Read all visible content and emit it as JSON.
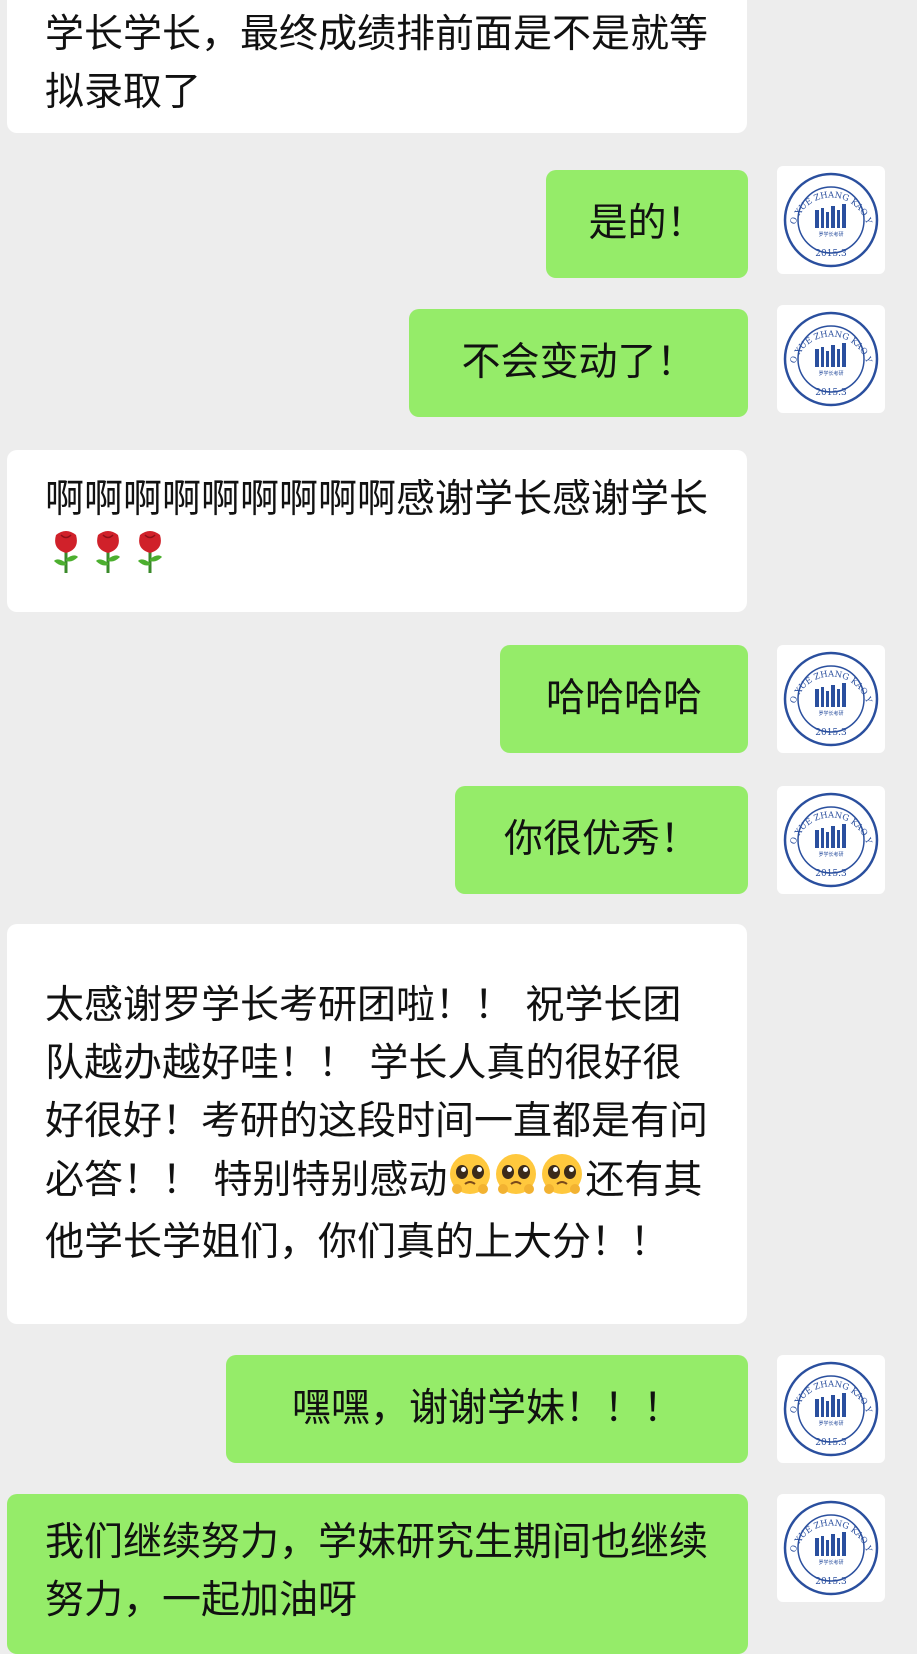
{
  "messages": [
    {
      "side": "left",
      "text": "学长学长，最终成绩排前面是不是就等拟录取了"
    },
    {
      "side": "right",
      "text": "是的！"
    },
    {
      "side": "right",
      "text": "不会变动了！"
    },
    {
      "side": "left",
      "text": "啊啊啊啊啊啊啊啊啊感谢学长感谢学长",
      "emoji": [
        "rose-icon",
        "rose-icon",
        "rose-icon"
      ]
    },
    {
      "side": "right",
      "text": "哈哈哈哈"
    },
    {
      "side": "right",
      "text": "你很优秀！"
    },
    {
      "side": "left",
      "text_a": "太感谢罗学长考研团啦！！ 祝学长团队越办越好哇！！ 学长人真的很好很好很好！考研的这段时间一直都是有问必答！！ 特别特别感动",
      "emoji": [
        "pleading-face-icon",
        "pleading-face-icon",
        "pleading-face-icon"
      ],
      "text_b": "还有其他学长学姐们，你们真的上大分！！"
    },
    {
      "side": "right",
      "text": "嘿嘿，谢谢学妹！！！"
    },
    {
      "side": "right",
      "text": "我们继续努力，学妹研究生期间也继续努力，一起加油呀"
    }
  ],
  "avatar": {
    "arc_text": "LUO XUE ZHANG KAO YAN",
    "year": "2015.3",
    "seal_text": "罗学长考研",
    "colors": {
      "ring": "#2a4f9e",
      "bars": "#2a4f9e"
    }
  },
  "colors": {
    "background": "#ededed",
    "bubble_incoming": "#ffffff",
    "bubble_outgoing": "#95ec69",
    "text": "#111111"
  }
}
